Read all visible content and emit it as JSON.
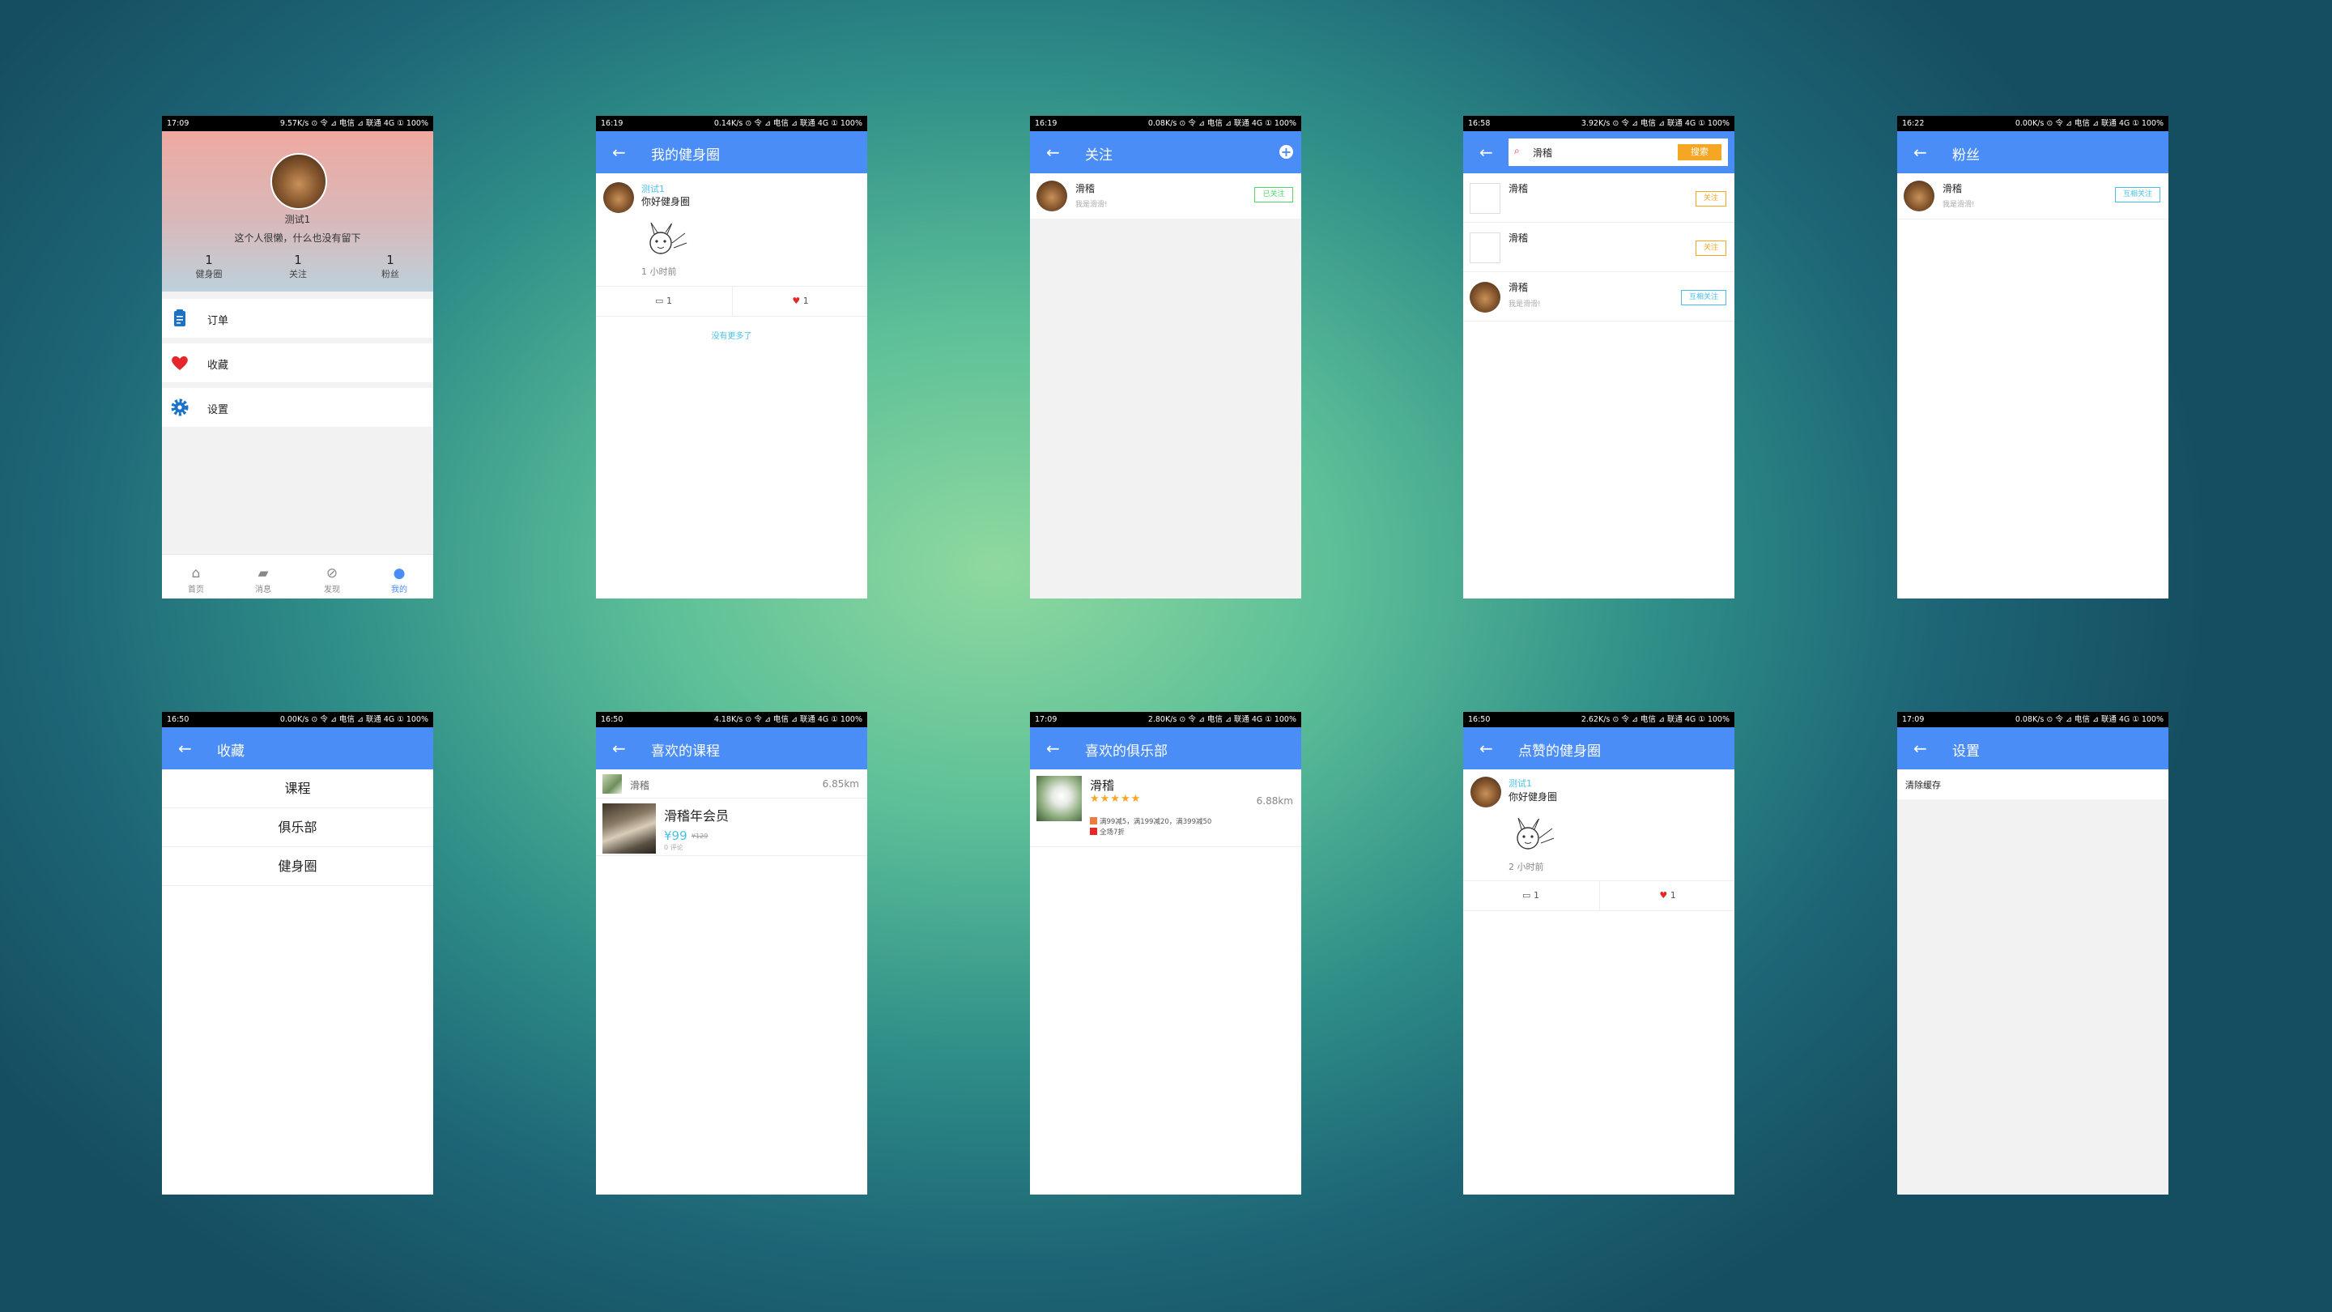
{
  "status_bars": [
    {
      "time": "17:09",
      "right": "9.57K/s ⊙ 令 ⊿ 电信 ⊿ 联通 4G ① 100%"
    },
    {
      "time": "16:19",
      "right": "0.14K/s ⊙ 令 ⊿ 电信 ⊿ 联通 4G ① 100%"
    },
    {
      "time": "16:19",
      "right": "0.08K/s ⊙ 令 ⊿ 电信 ⊿ 联通 4G ① 100%"
    },
    {
      "time": "16:58",
      "right": "3.92K/s ⊙ 令 ⊿ 电信 ⊿ 联通 4G ① 100%"
    },
    {
      "time": "16:22",
      "right": "0.00K/s ⊙ 令 ⊿ 电信 ⊿ 联通 4G ① 100%"
    },
    {
      "time": "16:50",
      "right": "0.00K/s ⊙ 令 ⊿ 电信 ⊿ 联通 4G ① 100%"
    },
    {
      "time": "16:50",
      "right": "4.18K/s ⊙ 令 ⊿ 电信 ⊿ 联通 4G ① 100%"
    },
    {
      "time": "17:09",
      "right": "2.80K/s ⊙ 令 ⊿ 电信 ⊿ 联通 4G ① 100%"
    },
    {
      "time": "16:50",
      "right": "2.62K/s ⊙ 令 ⊿ 电信 ⊿ 联通 4G ① 100%"
    },
    {
      "time": "17:09",
      "right": "0.08K/s ⊙ 令 ⊿ 电信 ⊿ 联通 4G ① 100%"
    }
  ],
  "profile": {
    "username": "测试1",
    "bio": "这个人很懒，什么也没有留下",
    "stats": [
      {
        "value": "1",
        "label": "健身圈"
      },
      {
        "value": "1",
        "label": "关注"
      },
      {
        "value": "1",
        "label": "粉丝"
      }
    ],
    "menu": [
      {
        "label": "订单",
        "icon": "clipboard-icon"
      },
      {
        "label": "收藏",
        "icon": "heart-icon"
      },
      {
        "label": "设置",
        "icon": "gear-icon"
      }
    ],
    "tabs": [
      {
        "label": "首页",
        "icon": "home-icon"
      },
      {
        "label": "消息",
        "icon": "message-icon"
      },
      {
        "label": "发现",
        "icon": "compass-icon"
      },
      {
        "label": "我的",
        "icon": "person-icon"
      }
    ],
    "active_tab_color": "#4a8df7"
  },
  "my_circle": {
    "title": "我的健身圈",
    "post": {
      "author": "测试1",
      "text": "你好健身圈",
      "time": "1 小时前",
      "comments": "1",
      "likes": "1"
    },
    "no_more": "没有更多了"
  },
  "following": {
    "title": "关注",
    "user": {
      "name": "滑稽",
      "bio": "我是滑滑!"
    },
    "button": "已关注"
  },
  "search": {
    "query": "滑稽",
    "button": "搜索",
    "results": [
      {
        "name": "滑稽",
        "bio": "",
        "button": "关注"
      },
      {
        "name": "滑稽",
        "bio": "",
        "button": "关注"
      },
      {
        "name": "滑稽",
        "bio": "我是滑滑!",
        "button": "互相关注"
      }
    ]
  },
  "fans": {
    "title": "粉丝",
    "user": {
      "name": "滑稽",
      "bio": "我是滑滑!"
    },
    "button": "互相关注"
  },
  "favorites": {
    "title": "收藏",
    "items": [
      "课程",
      "俱乐部",
      "健身圈"
    ]
  },
  "fav_courses": {
    "title": "喜欢的课程",
    "club": "滑稽",
    "distance": "6.85km",
    "course": {
      "name": "滑稽年会员",
      "price": "¥99",
      "old_price": "¥129",
      "sold": "0 评论"
    }
  },
  "fav_clubs": {
    "title": "喜欢的俱乐部",
    "club": {
      "name": "滑稽",
      "distance": "6.88km",
      "promo1": "满99减5，满199减20，满399减50",
      "promo2": "全场7折"
    }
  },
  "liked_circle": {
    "title": "点赞的健身圈",
    "post": {
      "author": "测试1",
      "text": "你好健身圈",
      "time": "2 小时前",
      "comments": "1",
      "likes": "1"
    }
  },
  "settings": {
    "title": "设置",
    "item": "清除缓存"
  },
  "colors": {
    "appbar": "#4a8df7",
    "orange": "#f5a623",
    "cyan": "#4ac0e8",
    "green": "#4cd964",
    "red": "#e5262b"
  }
}
